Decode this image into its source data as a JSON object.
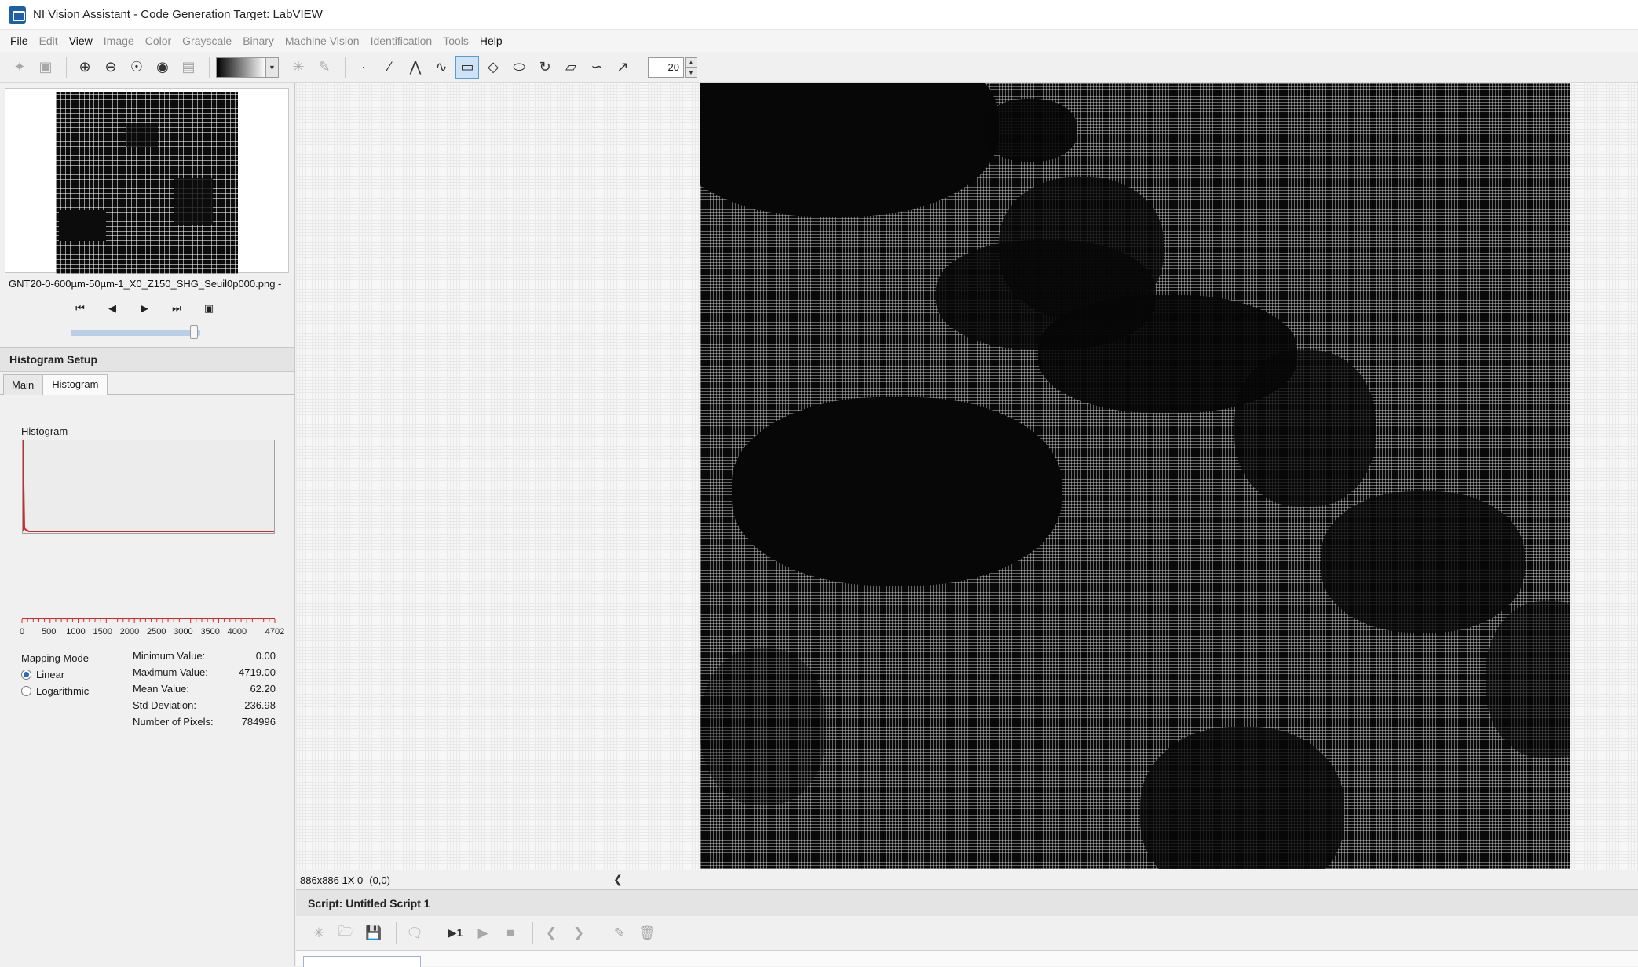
{
  "window": {
    "title": "NI Vision Assistant - Code Generation Target: LabVIEW"
  },
  "menu": [
    {
      "label": "File",
      "enabled": true
    },
    {
      "label": "Edit",
      "enabled": false
    },
    {
      "label": "View",
      "enabled": true
    },
    {
      "label": "Image",
      "enabled": false
    },
    {
      "label": "Color",
      "enabled": false
    },
    {
      "label": "Grayscale",
      "enabled": false
    },
    {
      "label": "Binary",
      "enabled": false
    },
    {
      "label": "Machine Vision",
      "enabled": false
    },
    {
      "label": "Identification",
      "enabled": false
    },
    {
      "label": "Tools",
      "enabled": false
    },
    {
      "label": "Help",
      "enabled": true
    }
  ],
  "toolbar": {
    "zoom_value": "20",
    "active_tool": "rectangle-roi"
  },
  "browser": {
    "filename": "GNT20-0-600µm-50µm-1_X0_Z150_SHG_Seuil0p000.png -",
    "slider_fraction": 0.95
  },
  "setup": {
    "header": "Histogram Setup",
    "tabs": [
      {
        "label": "Main",
        "selected": false
      },
      {
        "label": "Histogram",
        "selected": true
      }
    ]
  },
  "histogram": {
    "label": "Histogram",
    "ticks": [
      "0",
      "500",
      "1000",
      "1500",
      "2000",
      "2500",
      "3000",
      "3500",
      "4000",
      "4702"
    ],
    "mapping_mode_label": "Mapping Mode",
    "modes": [
      {
        "label": "Linear",
        "selected": true
      },
      {
        "label": "Logarithmic",
        "selected": false
      }
    ],
    "stats": [
      {
        "label": "Minimum Value:",
        "value": "0.00"
      },
      {
        "label": "Maximum Value:",
        "value": "4719.00"
      },
      {
        "label": "Mean Value:",
        "value": "62.20"
      },
      {
        "label": "Std Deviation:",
        "value": "236.98"
      },
      {
        "label": "Number of Pixels:",
        "value": "784996"
      }
    ]
  },
  "status": {
    "size": "886x886 1X 0",
    "coords": "(0,0)"
  },
  "script": {
    "header": "Script: Untitled Script 1",
    "step_label": "▶1"
  },
  "colors": {
    "accent": "#5b9bd5",
    "histogram_line": "#d62828",
    "radio_selected": "#2769c0"
  }
}
